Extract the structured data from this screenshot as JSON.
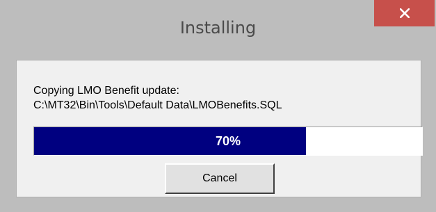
{
  "window": {
    "title": "Installing",
    "close_icon": "close-icon"
  },
  "message": {
    "line1": "Copying LMO Benefit update:",
    "line2": "C:\\MT32\\Bin\\Tools\\Default Data\\LMOBenefits.SQL"
  },
  "progress": {
    "value": 0.7,
    "label": "70%"
  },
  "buttons": {
    "cancel_label": "Cancel"
  },
  "colors": {
    "close_button": "#c7504b",
    "progress_fill": "#000080",
    "frame": "#bdbdbd",
    "client": "#f0f0f0"
  }
}
